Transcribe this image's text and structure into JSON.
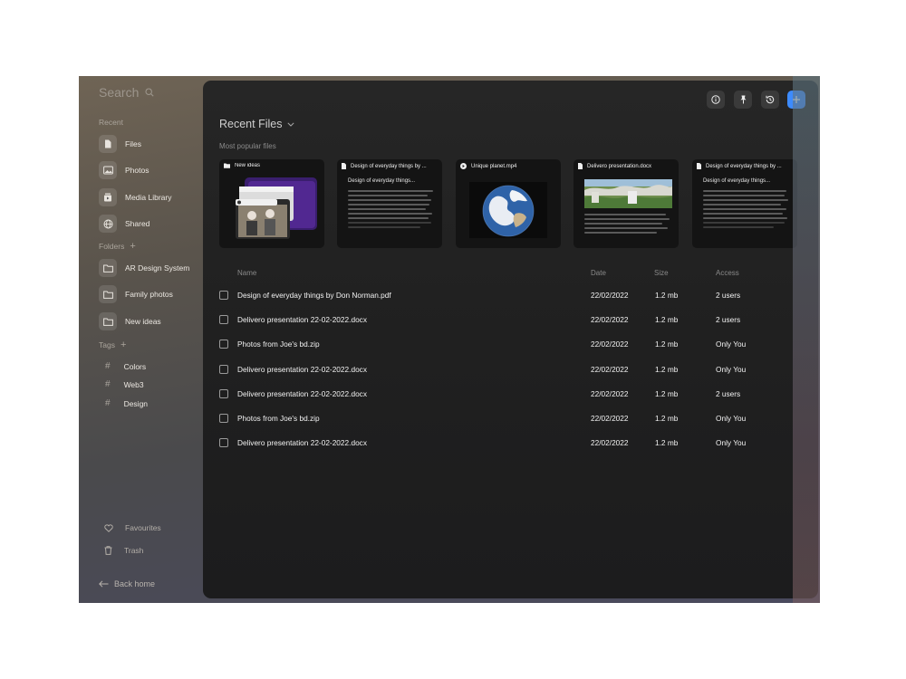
{
  "sidebar": {
    "search_placeholder": "Search",
    "recent_label": "Recent",
    "recent_items": [
      {
        "label": "Files",
        "icon": "file-icon"
      },
      {
        "label": "Photos",
        "icon": "image-icon"
      },
      {
        "label": "Media Library",
        "icon": "media-library-icon"
      },
      {
        "label": "Shared",
        "icon": "globe-icon"
      }
    ],
    "folders_label": "Folders",
    "folders": [
      "AR Design System",
      "Family photos",
      "New ideas"
    ],
    "tags_label": "Tags",
    "tags": [
      "Colors",
      "Web3",
      "Design"
    ],
    "favourites_label": "Favourites",
    "trash_label": "Trash",
    "back_label": "Back home"
  },
  "toolbar": {
    "buttons": [
      "info-icon",
      "pin-icon",
      "history-icon",
      "plus-icon"
    ],
    "accent_color": "#3d8bfd"
  },
  "main": {
    "title": "Recent Files",
    "subtitle": "Most popular files",
    "cards": [
      {
        "name": "New ideas",
        "icon": "folder-icon",
        "kind": "folder"
      },
      {
        "name": "Design of everyday things by ...",
        "icon": "doc-icon",
        "kind": "doc",
        "doc_title": "Design of everyday things..."
      },
      {
        "name": "Unique planet.mp4",
        "icon": "play-icon",
        "kind": "video"
      },
      {
        "name": "Delivero presentation.docx",
        "icon": "doc-icon",
        "kind": "presentation"
      },
      {
        "name": "Design of everyday things by ...",
        "icon": "doc-icon",
        "kind": "doc",
        "doc_title": "Design of everyday things..."
      }
    ],
    "table": {
      "headers": {
        "name": "Name",
        "date": "Date",
        "size": "Size",
        "access": "Access"
      },
      "rows": [
        {
          "name": "Design of everyday things by Don Norman.pdf",
          "date": "22/02/2022",
          "size": "1.2 mb",
          "access": "2 users"
        },
        {
          "name": "Delivero presentation 22-02-2022.docx",
          "date": "22/02/2022",
          "size": "1.2 mb",
          "access": "2 users"
        },
        {
          "name": "Photos from Joe's bd.zip",
          "date": "22/02/2022",
          "size": "1.2 mb",
          "access": "Only You"
        },
        {
          "name": "Delivero presentation 22-02-2022.docx",
          "date": "22/02/2022",
          "size": "1.2 mb",
          "access": "Only You"
        },
        {
          "name": "Delivero presentation 22-02-2022.docx",
          "date": "22/02/2022",
          "size": "1.2 mb",
          "access": "2 users"
        },
        {
          "name": "Photos from Joe's bd.zip",
          "date": "22/02/2022",
          "size": "1.2 mb",
          "access": "Only You"
        },
        {
          "name": "Delivero presentation 22-02-2022.docx",
          "date": "22/02/2022",
          "size": "1.2 mb",
          "access": "Only You"
        }
      ]
    }
  }
}
